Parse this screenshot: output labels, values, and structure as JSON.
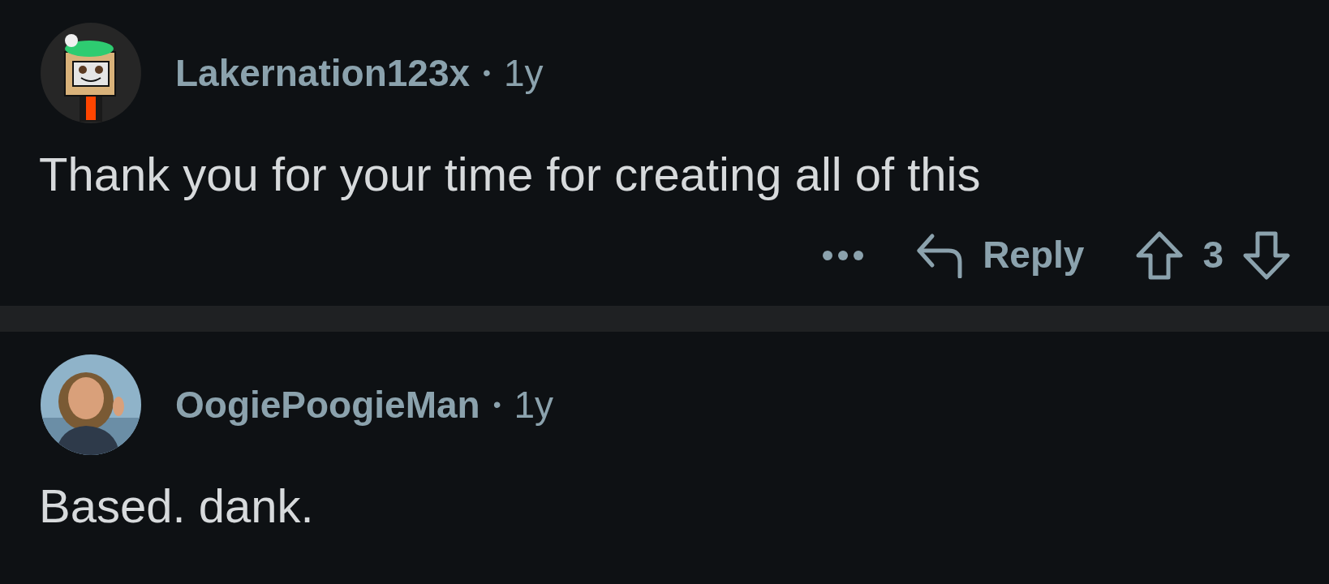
{
  "comments": [
    {
      "username": "Lakernation123x",
      "separator": "•",
      "age": "1y",
      "body": "Thank you for your time for creating all of this",
      "avatar": {
        "kind": "cartoon"
      },
      "actions": {
        "reply_label": "Reply",
        "score": "3"
      }
    },
    {
      "username": "OogiePoogieMan",
      "separator": "•",
      "age": "1y",
      "body": "Based. dank."
    }
  ]
}
